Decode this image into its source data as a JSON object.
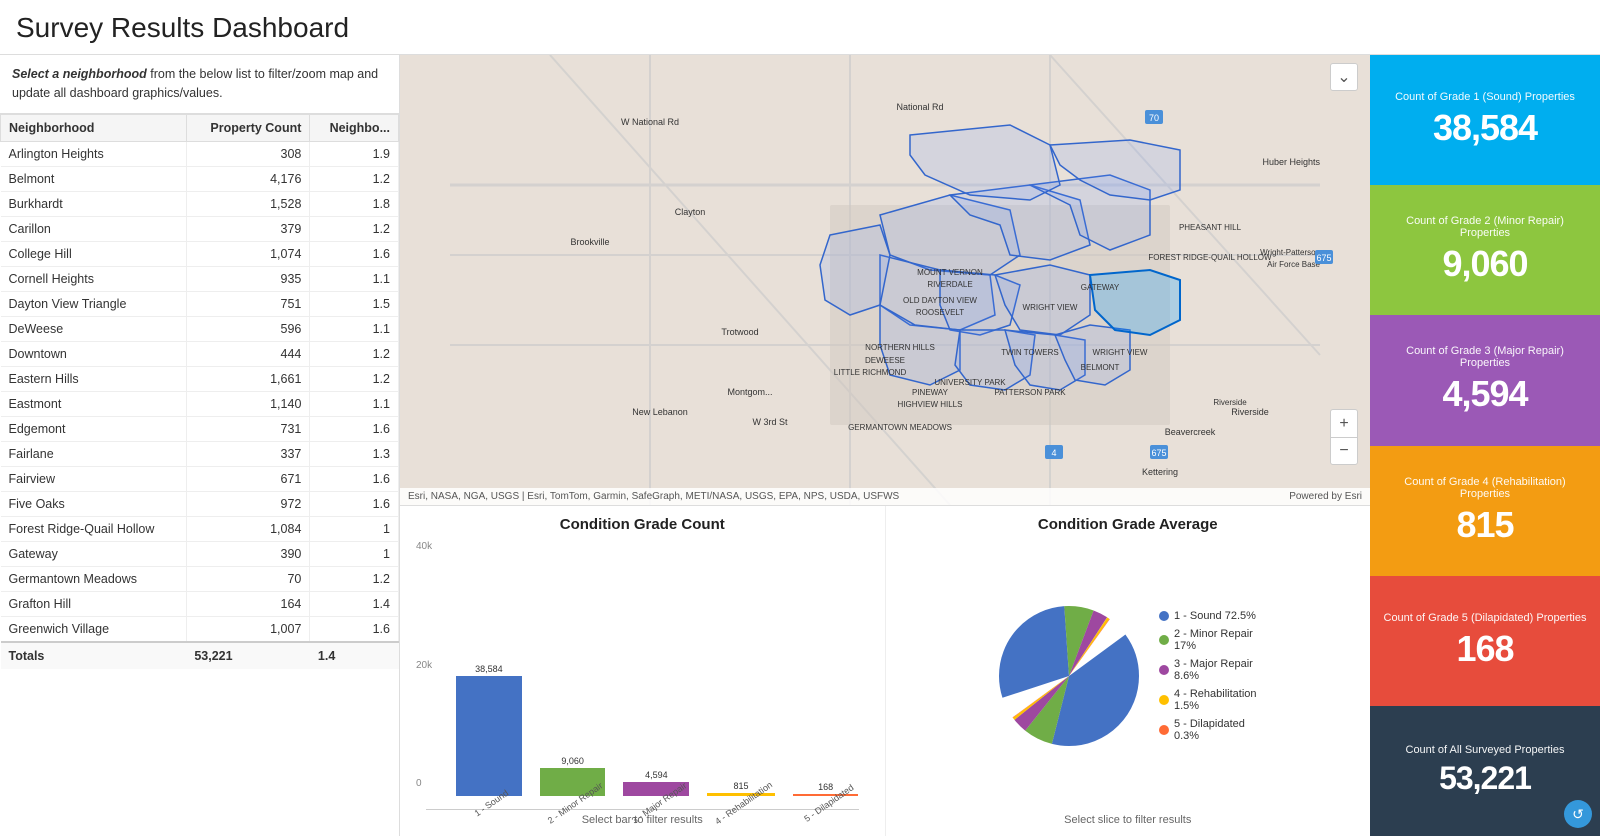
{
  "title": "Survey Results Dashboard",
  "filter_instruction": "Select a neighborhood from the below list to filter/zoom map and update all dashboard graphics/values.",
  "table": {
    "headers": [
      "Neighborhood",
      "Property Count",
      "Neighbo..."
    ],
    "rows": [
      {
        "name": "Arlington Heights",
        "count": 308,
        "avg": 1.9
      },
      {
        "name": "Belmont",
        "count": 4176,
        "avg": 1.2
      },
      {
        "name": "Burkhardt",
        "count": 1528,
        "avg": 1.8
      },
      {
        "name": "Carillon",
        "count": 379,
        "avg": 1.2
      },
      {
        "name": "College Hill",
        "count": 1074,
        "avg": 1.6
      },
      {
        "name": "Cornell Heights",
        "count": 935,
        "avg": 1.1
      },
      {
        "name": "Dayton View Triangle",
        "count": 751,
        "avg": 1.5
      },
      {
        "name": "DeWeese",
        "count": 596,
        "avg": 1.1
      },
      {
        "name": "Downtown",
        "count": 444,
        "avg": 1.2
      },
      {
        "name": "Eastern Hills",
        "count": 1661,
        "avg": 1.2
      },
      {
        "name": "Eastmont",
        "count": 1140,
        "avg": 1.1
      },
      {
        "name": "Edgemont",
        "count": 731,
        "avg": 1.6
      },
      {
        "name": "Fairlane",
        "count": 337,
        "avg": 1.3
      },
      {
        "name": "Fairview",
        "count": 671,
        "avg": 1.6
      },
      {
        "name": "Five Oaks",
        "count": 972,
        "avg": 1.6
      },
      {
        "name": "Forest Ridge-Quail Hollow",
        "count": 1084,
        "avg": 1
      },
      {
        "name": "Gateway",
        "count": 390,
        "avg": 1
      },
      {
        "name": "Germantown Meadows",
        "count": 70,
        "avg": 1.2
      },
      {
        "name": "Grafton Hill",
        "count": 164,
        "avg": 1.4
      },
      {
        "name": "Greenwich Village",
        "count": 1007,
        "avg": 1.6
      }
    ],
    "totals": {
      "label": "Totals",
      "count": "53,221",
      "avg": 1.4
    }
  },
  "map": {
    "attribution": "Esri, NASA, NGA, USGS | Esri, TomTom, Garmin, SafeGraph, METI/NASA, USGS, EPA, NPS, USDA, USFWS",
    "powered_by": "Powered by Esri"
  },
  "bar_chart": {
    "title": "Condition Grade Count",
    "note": "Select bar to filter results",
    "bars": [
      {
        "label": "1 - Sound",
        "value": 38584,
        "display": "38,584",
        "color": "#4472C4",
        "height_pct": 100
      },
      {
        "label": "2 - Minor Repair",
        "value": 9060,
        "display": "9,060",
        "color": "#70AD47",
        "height_pct": 23.5
      },
      {
        "label": "3 - Major Repair",
        "value": 4594,
        "display": "4,594",
        "color": "#9E48A0",
        "height_pct": 12
      },
      {
        "label": "4 - Rehabilitation",
        "value": 815,
        "display": "815",
        "color": "#FFC000",
        "height_pct": 2.1
      },
      {
        "label": "5 - Dilapidated",
        "value": 168,
        "display": "168",
        "color": "#FF6B35",
        "height_pct": 0.4
      }
    ],
    "y_labels": [
      "40k",
      "20k",
      "0"
    ]
  },
  "pie_chart": {
    "title": "Condition Grade Average",
    "note": "Select slice to filter results",
    "slices": [
      {
        "label": "1 - Sound",
        "pct": 72.5,
        "color": "#4472C4"
      },
      {
        "label": "2 - Minor Repair",
        "pct": 17,
        "color": "#70AD47"
      },
      {
        "label": "3 - Major Repair",
        "pct": 8.6,
        "color": "#9E48A0"
      },
      {
        "label": "4 - Rehabilitation",
        "pct": 1.5,
        "color": "#FFC000"
      },
      {
        "label": "5 - Dilapidated",
        "pct": 0.3,
        "color": "#FF6B35"
      }
    ]
  },
  "stats": [
    {
      "label": "Count of Grade 1 (Sound) Properties",
      "value": "38,584",
      "color_class": "card-blue"
    },
    {
      "label": "Count of Grade 2 (Minor Repair) Properties",
      "value": "9,060",
      "color_class": "card-green"
    },
    {
      "label": "Count of Grade 3 (Major Repair) Properties",
      "value": "4,594",
      "color_class": "card-purple"
    },
    {
      "label": "Count of Grade 4 (Rehabilitation) Properties",
      "value": "815",
      "color_class": "card-orange"
    },
    {
      "label": "Count of Grade 5 (Dilapidated) Properties",
      "value": "168",
      "color_class": "card-red"
    },
    {
      "label": "Count of All Surveyed Properties",
      "value": "53,221",
      "color_class": "card-dark"
    }
  ]
}
